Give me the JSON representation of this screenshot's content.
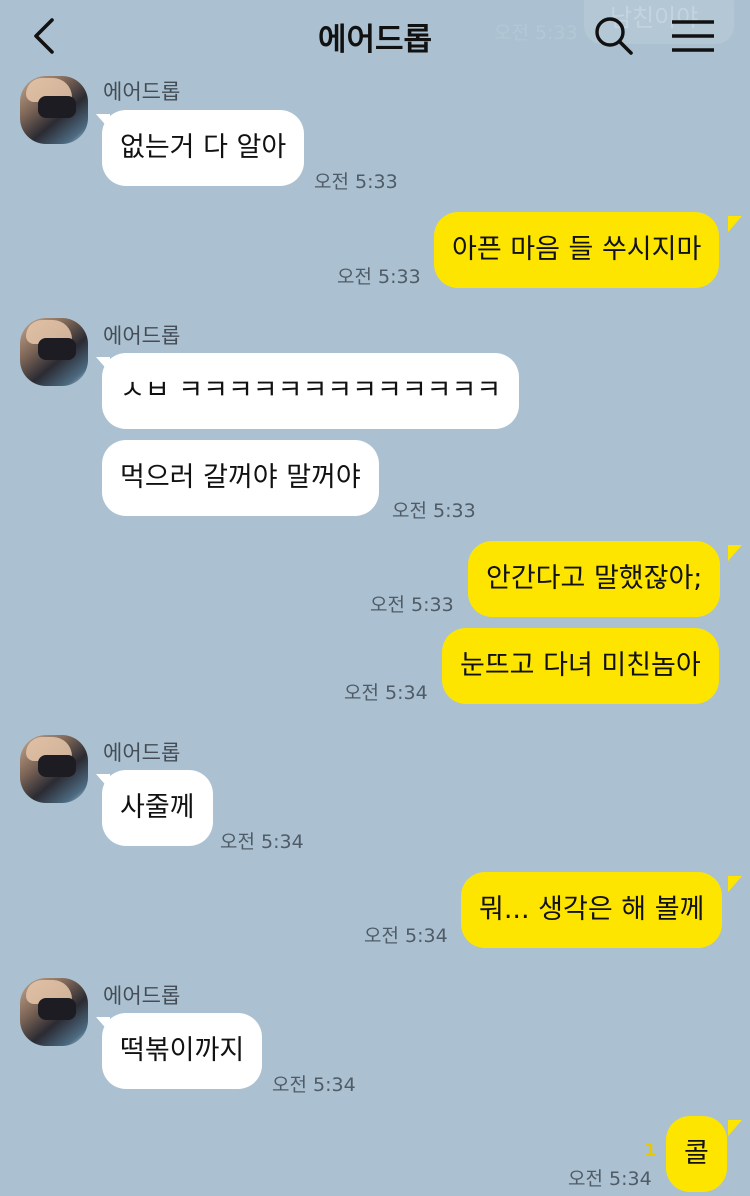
{
  "header": {
    "title": "에어드롭",
    "ghost_text": "남친이야",
    "ghost_time": "오전 5:33"
  },
  "icons": {
    "back": "chevron-left-icon",
    "search": "search-icon",
    "menu": "hamburger-menu-icon"
  },
  "colors": {
    "background": "#abc1d1",
    "incoming_bubble": "#ffffff",
    "outgoing_bubble": "#fee500",
    "unread": "#e8c800"
  },
  "messages": [
    {
      "sender": "에어드롭",
      "text": "없는거 다 알아",
      "time": "오전 5:33"
    },
    {
      "text": "아픈 마음 들 쑤시지마",
      "time": "오전 5:33"
    },
    {
      "sender": "에어드롭",
      "text": "ㅅㅂ ㅋㅋㅋㅋㅋㅋㅋㅋㅋㅋㅋㅋㅋ"
    },
    {
      "text": "먹으러 갈꺼야 말꺼야",
      "time": "오전 5:33"
    },
    {
      "text": "안간다고 말했잖아;",
      "time": "오전 5:33"
    },
    {
      "text": "눈뜨고 다녀 미친놈아",
      "time": "오전 5:34"
    },
    {
      "sender": "에어드롭",
      "text": "사줄께",
      "time": "오전 5:34"
    },
    {
      "text": "뭐... 생각은 해 볼께",
      "time": "오전 5:34"
    },
    {
      "sender": "에어드롭",
      "text": "떡볶이까지",
      "time": "오전 5:34"
    },
    {
      "text": "콜",
      "time": "오전 5:34",
      "unread": "1"
    }
  ]
}
